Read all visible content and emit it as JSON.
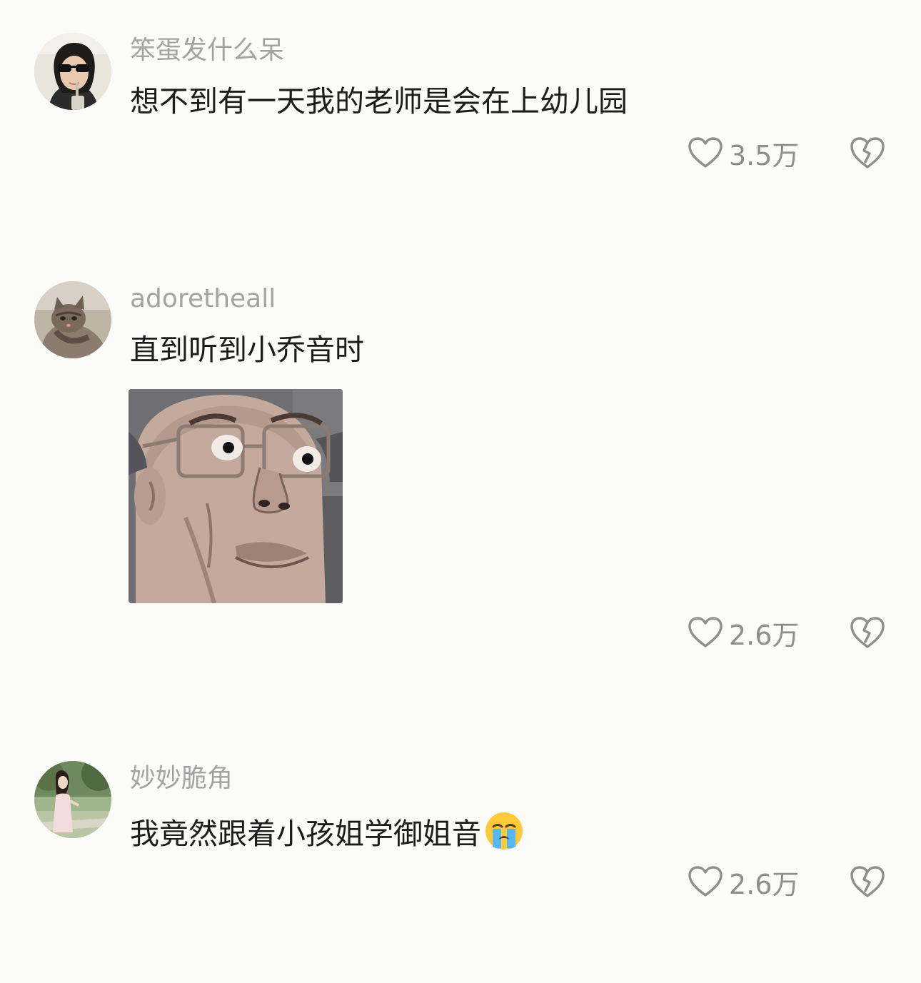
{
  "comments": [
    {
      "username": "笨蛋发什么呆",
      "text": "想不到有一天我的老师是会在上幼儿园",
      "likes": "3.5万"
    },
    {
      "username": "adoretheall",
      "text": "直到听到小乔音时",
      "likes": "2.6万"
    },
    {
      "username": "妙妙脆角",
      "text": "我竟然跟着小孩姐学御姐音",
      "likes": "2.6万"
    }
  ],
  "icons": {
    "like": "heart-outline-icon",
    "dislike": "broken-heart-outline-icon",
    "emoji": "loudly-crying-face-emoji"
  },
  "colors": {
    "background": "#fbfbf9",
    "username": "#a3a3a3",
    "text": "#1c1c1c",
    "count": "#8e8e8e"
  }
}
